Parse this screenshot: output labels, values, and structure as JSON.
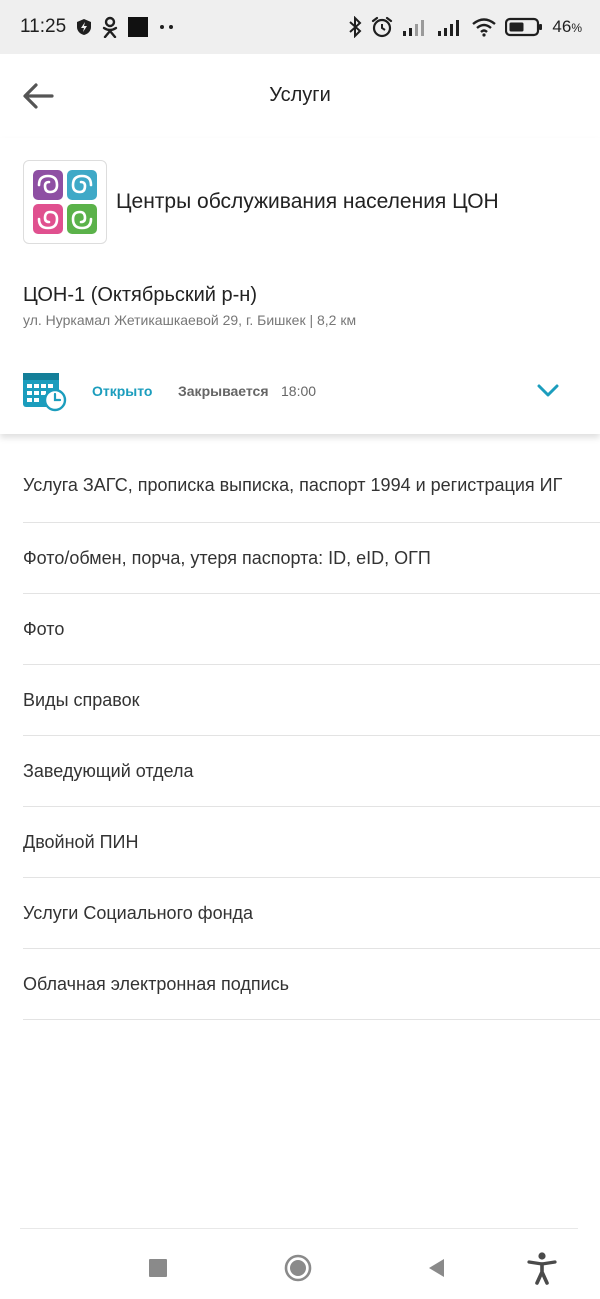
{
  "status_bar": {
    "time": "11:25",
    "battery_percent": "46",
    "battery_suffix": "%",
    "icons": [
      "shield-icon",
      "odnoklassniki-icon",
      "black-square-icon",
      "more-dots-icon",
      "bluetooth-icon",
      "alarm-icon",
      "signal-icon",
      "signal-icon",
      "wifi-icon",
      "battery-icon"
    ]
  },
  "header": {
    "title": "Услуги",
    "back_icon": "arrow-left-icon"
  },
  "organization": {
    "name": "Центры обслуживания населения ЦОН",
    "logo_colors": [
      "#8e4fa3",
      "#3fa9c7",
      "#e0508f",
      "#5bb24a"
    ]
  },
  "branch": {
    "name": "ЦОН-1 (Октябрьский р-н)",
    "address": "ул. Нуркамал Жетикашкаевой 29, г. Бишкек | 8,2 км"
  },
  "hours": {
    "status": "Открыто",
    "closes_label": "Закрывается",
    "closes_time": "18:00",
    "accent_color": "#1b9dbd"
  },
  "services": [
    "Услуга ЗАГС, прописка выписка, паспорт 1994 и регистрация ИГ",
    "Фото/обмен, порча, утеря паспорта: ID, eID, ОГП",
    "Фото",
    "Виды справок",
    "Заведующий отдела",
    "Двойной ПИН",
    "Услуги Социального фонда",
    "Облачная электронная подпись"
  ],
  "nav_bar": {
    "icons": [
      "recents-square-icon",
      "home-circle-icon",
      "back-triangle-icon",
      "accessibility-icon"
    ]
  }
}
